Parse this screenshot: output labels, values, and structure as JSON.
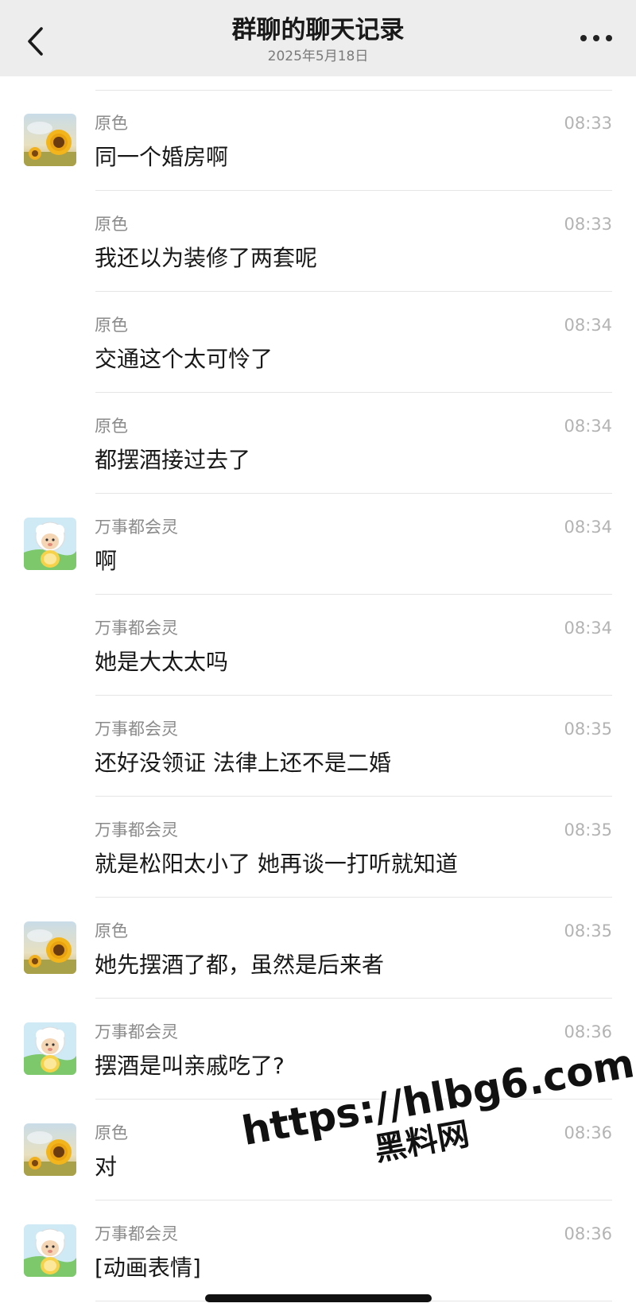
{
  "header": {
    "back_icon": "chevron-left-icon",
    "title": "群聊的聊天记录",
    "date": "2025年5月18日",
    "more_icon": "ellipsis-icon"
  },
  "avatars": {
    "yuanse": "sunflower-avatar",
    "wanshi": "lamb-cartoon-avatar"
  },
  "messages": [
    {
      "sender": "原色",
      "time": "08:33",
      "text": "同一个婚房啊",
      "avatar": "yuanse",
      "show_avatar": true
    },
    {
      "sender": "原色",
      "time": "08:33",
      "text": "我还以为装修了两套呢",
      "avatar": "yuanse",
      "show_avatar": false
    },
    {
      "sender": "原色",
      "time": "08:34",
      "text": "交通这个太可怜了",
      "avatar": "yuanse",
      "show_avatar": false
    },
    {
      "sender": "原色",
      "time": "08:34",
      "text": "都摆酒接过去了",
      "avatar": "yuanse",
      "show_avatar": false
    },
    {
      "sender": "万事都会灵",
      "time": "08:34",
      "text": "啊",
      "avatar": "wanshi",
      "show_avatar": true
    },
    {
      "sender": "万事都会灵",
      "time": "08:34",
      "text": "她是大太太吗",
      "avatar": "wanshi",
      "show_avatar": false
    },
    {
      "sender": "万事都会灵",
      "time": "08:35",
      "text": "还好没领证 法律上还不是二婚",
      "avatar": "wanshi",
      "show_avatar": false
    },
    {
      "sender": "万事都会灵",
      "time": "08:35",
      "text": "就是松阳太小了 她再谈一打听就知道",
      "avatar": "wanshi",
      "show_avatar": false
    },
    {
      "sender": "原色",
      "time": "08:35",
      "text": "她先摆酒了都，虽然是后来者",
      "avatar": "yuanse",
      "show_avatar": true
    },
    {
      "sender": "万事都会灵",
      "time": "08:36",
      "text": "摆酒是叫亲戚吃了?",
      "avatar": "wanshi",
      "show_avatar": true
    },
    {
      "sender": "原色",
      "time": "08:36",
      "text": "对",
      "avatar": "yuanse",
      "show_avatar": true
    },
    {
      "sender": "万事都会灵",
      "time": "08:36",
      "text": "[动画表情]",
      "avatar": "wanshi",
      "show_avatar": true
    }
  ],
  "watermark": {
    "url": "https://hlbg6.com",
    "site": "黑料网"
  }
}
